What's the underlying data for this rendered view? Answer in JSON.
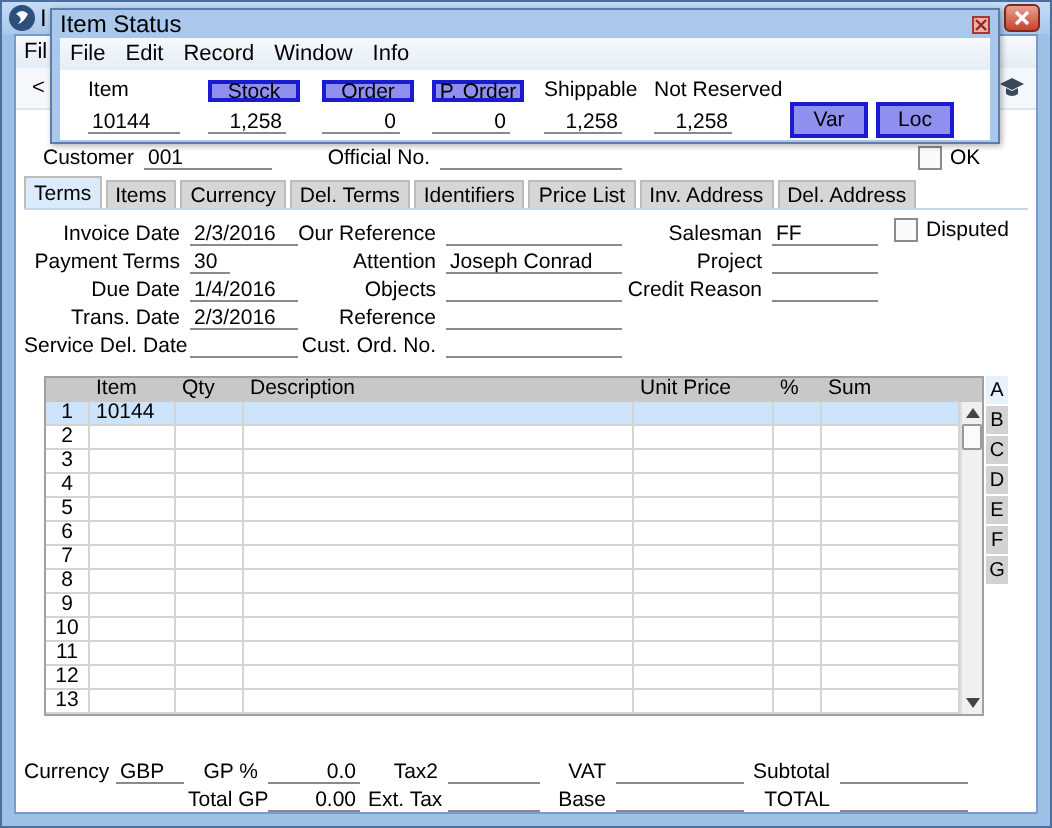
{
  "background_window": {
    "title": "I",
    "menu": [
      "Fil"
    ],
    "toolbar": {
      "back_button": "<"
    }
  },
  "item_status": {
    "title": "Item Status",
    "menu": [
      "File",
      "Edit",
      "Record",
      "Window",
      "Info"
    ],
    "columns": [
      {
        "kind": "label",
        "heading": "Item",
        "value": "10144"
      },
      {
        "kind": "button",
        "heading": "Stock",
        "value": "1,258"
      },
      {
        "kind": "button",
        "heading": "Order",
        "value": "0"
      },
      {
        "kind": "button",
        "heading": "P. Order",
        "value": "0"
      },
      {
        "kind": "label",
        "heading": "Shippable",
        "value": "1,258"
      },
      {
        "kind": "label",
        "heading": "Not Reserved",
        "value": "1,258"
      }
    ],
    "buttons": [
      "Var",
      "Loc"
    ]
  },
  "header": {
    "customer": {
      "label": "Customer",
      "value": "001"
    },
    "official_no": {
      "label": "Official No."
    },
    "ok": {
      "label": "OK",
      "checked": false
    }
  },
  "tabs": [
    {
      "label": "Terms",
      "selected": true
    },
    {
      "label": "Items",
      "selected": false
    },
    {
      "label": "Currency",
      "selected": false
    },
    {
      "label": "Del. Terms",
      "selected": false
    },
    {
      "label": "Identifiers",
      "selected": false
    },
    {
      "label": "Price List",
      "selected": false
    },
    {
      "label": "Inv. Address",
      "selected": false
    },
    {
      "label": "Del. Address",
      "selected": false
    }
  ],
  "terms": {
    "column_1": [
      {
        "label": "Invoice Date",
        "value": "2/3/2016"
      },
      {
        "label": "Payment Terms",
        "value": "30",
        "kind": "short"
      },
      {
        "label": "Due Date",
        "value": "1/4/2016"
      },
      {
        "label": "Trans. Date",
        "value": "2/3/2016"
      },
      {
        "label": "Service Del. Date"
      }
    ],
    "column_2": [
      {
        "label": "Our Reference"
      },
      {
        "label": "Attention",
        "value": "Joseph Conrad"
      },
      {
        "label": "Objects"
      },
      {
        "label": "Reference"
      },
      {
        "label": "Cust. Ord. No."
      }
    ],
    "column_3": [
      {
        "label": "Salesman",
        "value": "FF"
      },
      {
        "label": "Project"
      },
      {
        "label": "Credit Reason"
      }
    ],
    "disputed": {
      "label": "Disputed",
      "checked": false
    }
  },
  "grid": {
    "columns": [
      "Item",
      "Qty",
      "Description",
      "Unit Price",
      "%",
      "Sum"
    ],
    "rows": [
      {
        "number": "1",
        "item": "10144",
        "selected": true
      },
      {
        "number": "2",
        "selected": false
      },
      {
        "number": "3",
        "selected": false
      },
      {
        "number": "4",
        "selected": false
      },
      {
        "number": "5",
        "selected": false
      },
      {
        "number": "6",
        "selected": false
      },
      {
        "number": "7",
        "selected": false
      },
      {
        "number": "8",
        "selected": false
      },
      {
        "number": "9",
        "selected": false
      },
      {
        "number": "10",
        "selected": false
      },
      {
        "number": "11",
        "selected": false
      },
      {
        "number": "12",
        "selected": false
      },
      {
        "number": "13",
        "selected": false
      }
    ]
  },
  "side_tabs": [
    {
      "label": "A",
      "selected": true
    },
    {
      "label": "B",
      "selected": false
    },
    {
      "label": "C",
      "selected": false
    },
    {
      "label": "D",
      "selected": false
    },
    {
      "label": "E",
      "selected": false
    },
    {
      "label": "F",
      "selected": false
    },
    {
      "label": "G",
      "selected": false
    }
  ],
  "footer": {
    "row_1": [
      {
        "label": "Currency",
        "value": "GBP",
        "kind": "text"
      },
      {
        "label": "GP %",
        "value": "0.0",
        "kind": "number"
      },
      {
        "label": "Tax2"
      },
      {
        "label": "VAT"
      },
      {
        "label": "Subtotal"
      }
    ],
    "row_2": [
      {
        "label": "Total GP",
        "value": "0.00",
        "kind": "number"
      },
      {
        "label": "Ext. Tax"
      },
      {
        "label": "Base"
      },
      {
        "label": "TOTAL"
      }
    ]
  }
}
